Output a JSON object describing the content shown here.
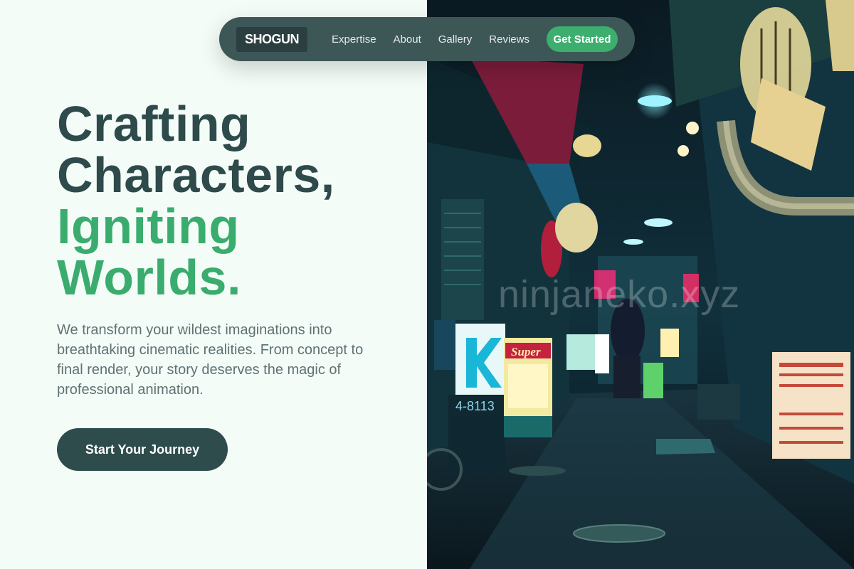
{
  "nav": {
    "logo": "SHOGUN",
    "links": [
      "Expertise",
      "About",
      "Gallery",
      "Reviews"
    ],
    "cta_label": "Get Started"
  },
  "hero": {
    "line1": "Crafting",
    "line2": "Characters,",
    "line3": "Igniting",
    "line4": "Worlds.",
    "description": "We transform your wildest imaginations into breathtaking cinematic realities. From concept to final render, your story deserves the magic of professional animation.",
    "cta_label": "Start Your Journey"
  },
  "image": {
    "watermark": "ninjaneko.xyz",
    "sign_super": "Super",
    "sign_number": "4-8113"
  },
  "colors": {
    "accent_green": "#3aac6e",
    "dark_teal": "#2e4a4a",
    "background": "#f4fcf8"
  }
}
